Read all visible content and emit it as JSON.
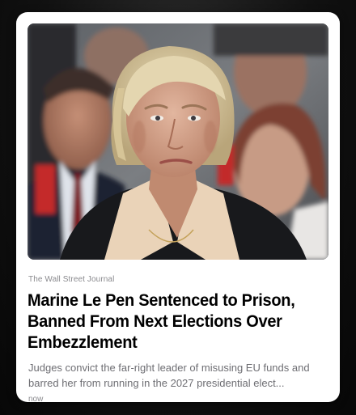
{
  "article": {
    "source": "The Wall Street Journal",
    "headline": "Marine Le Pen Sentenced to Prison, Banned From Next Elections Over Embezzlement",
    "summary": "Judges convict the far-right leader of misusing EU funds and barred her from running in the 2027 presidential elect...",
    "timestamp": "now"
  },
  "colors": {
    "card_background": "#ffffff",
    "headline": "#000000",
    "summary": "#6e6e73",
    "meta": "#8a8a8e"
  }
}
